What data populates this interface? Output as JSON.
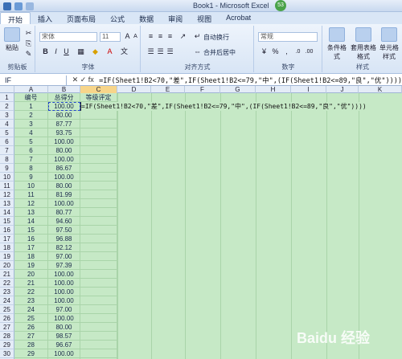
{
  "window": {
    "title": "Book1 - Microsoft Excel",
    "badge": "53"
  },
  "tabs": [
    "开始",
    "插入",
    "页面布局",
    "公式",
    "数据",
    "审阅",
    "视图",
    "Acrobat"
  ],
  "ribbon": {
    "clipboard": {
      "paste_label": "粘贴",
      "group_label": "剪贴板"
    },
    "font": {
      "name": "宋体",
      "size": "11",
      "group_label": "字体"
    },
    "alignment": {
      "wrap_label": "自动换行",
      "merge_label": "合并后居中",
      "group_label": "对齐方式"
    },
    "number": {
      "format": "常规",
      "group_label": "数字"
    },
    "styles": {
      "conditional_label": "条件格式",
      "table_label": "套用表格格式",
      "cell_label": "单元格样式",
      "group_label": "样式"
    }
  },
  "formula_bar": {
    "name_box": "IF",
    "fx": "fx",
    "formula": "=IF(Sheet1!B2<70,\"差\",IF(Sheet1!B2<=79,\"中\",(IF(Sheet1!B2<=89,\"良\",\"优\"))))"
  },
  "columns": [
    "A",
    "B",
    "C",
    "D",
    "E",
    "F",
    "G",
    "H",
    "I",
    "J",
    "K"
  ],
  "headers": {
    "a": "编号",
    "b": "总得分",
    "c": "等级评定"
  },
  "rows": [
    {
      "n": "1",
      "a": "",
      "b": ""
    },
    {
      "n": "2",
      "a": "1",
      "b": "100.00"
    },
    {
      "n": "3",
      "a": "2",
      "b": "80.00"
    },
    {
      "n": "4",
      "a": "3",
      "b": "87.77"
    },
    {
      "n": "5",
      "a": "4",
      "b": "93.75"
    },
    {
      "n": "6",
      "a": "5",
      "b": "100.00"
    },
    {
      "n": "7",
      "a": "6",
      "b": "80.00"
    },
    {
      "n": "8",
      "a": "7",
      "b": "100.00"
    },
    {
      "n": "9",
      "a": "8",
      "b": "86.67"
    },
    {
      "n": "10",
      "a": "9",
      "b": "100.00"
    },
    {
      "n": "11",
      "a": "10",
      "b": "80.00"
    },
    {
      "n": "12",
      "a": "11",
      "b": "81.99"
    },
    {
      "n": "13",
      "a": "12",
      "b": "100.00"
    },
    {
      "n": "14",
      "a": "13",
      "b": "80.77"
    },
    {
      "n": "15",
      "a": "14",
      "b": "94.60"
    },
    {
      "n": "16",
      "a": "15",
      "b": "97.50"
    },
    {
      "n": "17",
      "a": "16",
      "b": "96.88"
    },
    {
      "n": "18",
      "a": "17",
      "b": "82.12"
    },
    {
      "n": "19",
      "a": "18",
      "b": "97.00"
    },
    {
      "n": "20",
      "a": "19",
      "b": "97.39"
    },
    {
      "n": "21",
      "a": "20",
      "b": "100.00"
    },
    {
      "n": "22",
      "a": "21",
      "b": "100.00"
    },
    {
      "n": "23",
      "a": "22",
      "b": "100.00"
    },
    {
      "n": "24",
      "a": "23",
      "b": "100.00"
    },
    {
      "n": "25",
      "a": "24",
      "b": "97.00"
    },
    {
      "n": "26",
      "a": "25",
      "b": "100.00"
    },
    {
      "n": "27",
      "a": "26",
      "b": "80.00"
    },
    {
      "n": "28",
      "a": "27",
      "b": "98.57"
    },
    {
      "n": "29",
      "a": "28",
      "b": "96.67"
    },
    {
      "n": "30",
      "a": "29",
      "b": "100.00"
    },
    {
      "n": "31",
      "a": "30",
      "b": "100.00"
    }
  ],
  "cell_edit_text": "=IF(Sheet1!B2<70,\"差\",IF(Sheet1!B2<=79,\"中\",(IF(Sheet1!B2<=89,\"良\",\"优\"))))",
  "watermark": "Baidu 经验"
}
